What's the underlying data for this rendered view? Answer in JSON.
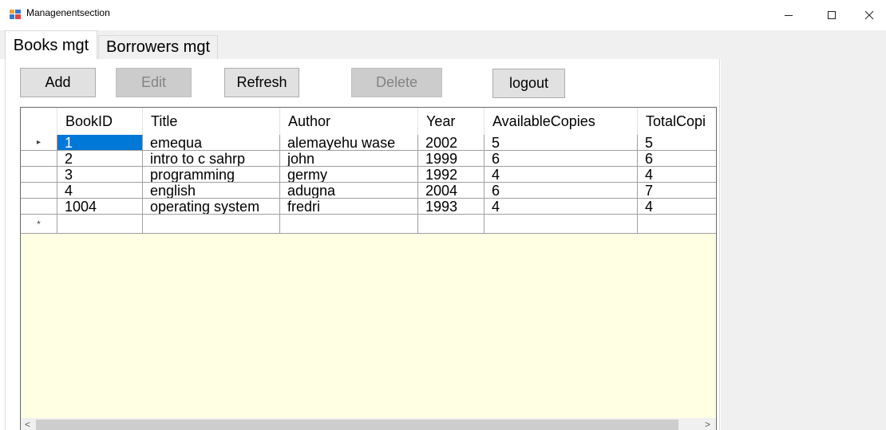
{
  "window": {
    "title": "Managenentsection",
    "minimize_symbol": "—",
    "maximize_symbol": "☐",
    "close_symbol": "✕"
  },
  "tabs": [
    {
      "label": "Books mgt",
      "active": true
    },
    {
      "label": "Borrowers mgt",
      "active": false
    }
  ],
  "toolbar": {
    "add": "Add",
    "edit": "Edit",
    "refresh": "Refresh",
    "delete": "Delete",
    "logout": "logout"
  },
  "grid": {
    "columns": [
      "BookID",
      "Title",
      "Author",
      "Year",
      "AvailableCopies",
      "TotalCopi"
    ],
    "rows": [
      [
        "1",
        "emequa",
        "alemayehu wase",
        "2002",
        "5",
        "5"
      ],
      [
        "2",
        "intro to c sahrp",
        "john",
        "1999",
        "6",
        "6"
      ],
      [
        "3",
        "programming",
        "germy",
        "1992",
        "4",
        "4"
      ],
      [
        "4",
        "english",
        "adugna",
        "2004",
        "6",
        "7"
      ],
      [
        "1004",
        "operating system",
        "fredri",
        "1993",
        "4",
        "4"
      ]
    ],
    "current_row_marker": "▸",
    "new_row_marker": "*",
    "selected_cell": "1"
  },
  "colors": {
    "selection": "#0078d7",
    "grid_background": "#ffffe4",
    "disabled_button": "#cccccc"
  },
  "scrollbar": {
    "left_arrow": "<",
    "right_arrow": ">"
  }
}
